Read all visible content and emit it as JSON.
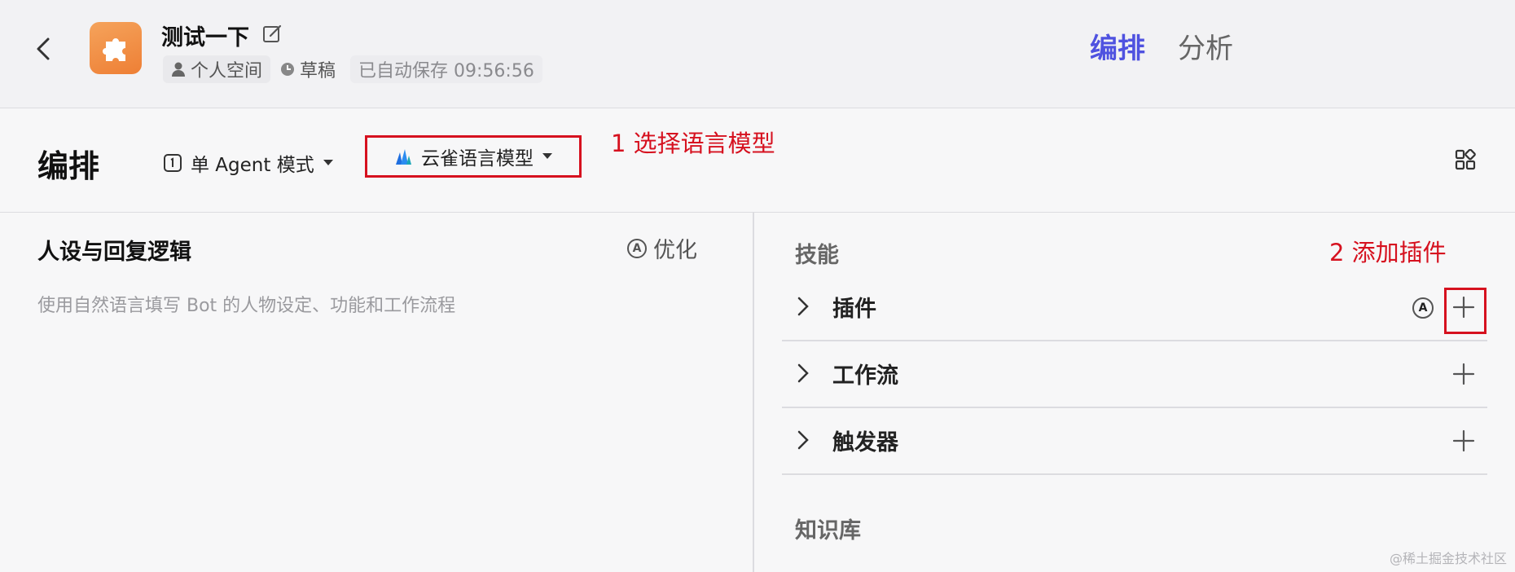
{
  "header": {
    "title": "测试一下",
    "meta": {
      "space": "个人空间",
      "status": "草稿",
      "autosave": "已自动保存 09:56:56"
    },
    "tabs": [
      {
        "label": "编排",
        "active": true
      },
      {
        "label": "分析",
        "active": false
      }
    ]
  },
  "toolbar": {
    "section_title": "编排",
    "mode_label": "单 Agent 模式",
    "model_label": "云雀语言模型",
    "annotation_1": "1 选择语言模型"
  },
  "left_pane": {
    "title": "人设与回复逻辑",
    "optimize_label": "优化",
    "placeholder": "使用自然语言填写 Bot 的人物设定、功能和工作流程"
  },
  "right_pane": {
    "skills_label": "技能",
    "annotation_2": "2 添加插件",
    "skills": [
      {
        "label": "插件"
      },
      {
        "label": "工作流"
      },
      {
        "label": "触发器"
      }
    ],
    "knowledge_label": "知识库"
  },
  "watermark": "@稀土掘金技术社区",
  "icons": {
    "back": "chevron-left-icon",
    "app": "puzzle-icon",
    "edit": "edit-icon",
    "user": "user-icon",
    "clock": "clock-icon",
    "mode": "agent-mode-icon",
    "model": "skylark-logo-icon",
    "grid": "grid-icon",
    "auto": "auto-a-icon",
    "expand": "chevron-right-icon",
    "add": "plus-icon"
  },
  "colors": {
    "accent": "#4f52e0",
    "annotation": "#d6111f",
    "app_icon": "#f08a3e"
  }
}
